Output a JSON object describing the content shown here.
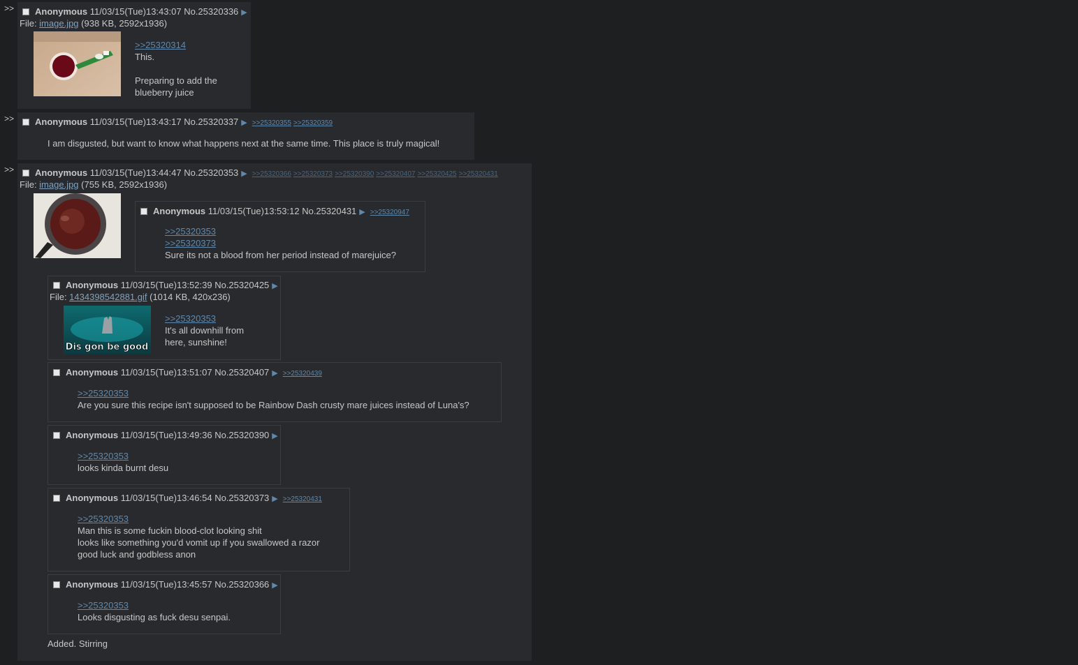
{
  "arrow": ">>",
  "post1": {
    "name": "Anonymous",
    "date": "11/03/15(Tue)13:43:07",
    "no": "No.25320336",
    "file_prefix": "File: ",
    "file_name": "image.jpg",
    "file_info": " (938 KB, 2592x1936)",
    "quote": ">>25320314",
    "line1": "This.",
    "line2": "Preparing to add the",
    "line3": "blueberry juice"
  },
  "post2": {
    "name": "Anonymous",
    "date": "11/03/15(Tue)13:43:17",
    "no": "No.25320337",
    "backlinks": [
      ">>25320355",
      ">>25320359"
    ],
    "text": "I am disgusted, but want to know what happens next at the same time. This place is truly magical!"
  },
  "post3": {
    "name": "Anonymous",
    "date": "11/03/15(Tue)13:44:47",
    "no": "No.25320353",
    "backlinks": [
      ">>25320366",
      ">>25320373",
      ">>25320390",
      ">>25320407",
      ">>25320425",
      ">>25320431"
    ],
    "file_prefix": "File: ",
    "file_name": "image.jpg",
    "file_info": " (755 KB, 2592x1936)",
    "text": "Added. Stirring"
  },
  "r431": {
    "name": "Anonymous",
    "date": "11/03/15(Tue)13:53:12",
    "no": "No.25320431",
    "backlinks": [
      ">>25320947"
    ],
    "quote1": ">>25320353",
    "quote2": ">>25320373",
    "text": "Sure its not a blood from her period instead of marejuice?"
  },
  "r425": {
    "name": "Anonymous",
    "date": "11/03/15(Tue)13:52:39",
    "no": "No.25320425",
    "file_prefix": "File: ",
    "file_name": "1434398542881.gif",
    "file_info": " (1014 KB, 420x236)",
    "gif_caption": "Dis gon be good",
    "quote": ">>25320353",
    "line1": "It's all downhill from",
    "line2": "here, sunshine!"
  },
  "r407": {
    "name": "Anonymous",
    "date": "11/03/15(Tue)13:51:07",
    "no": "No.25320407",
    "backlinks": [
      ">>25320439"
    ],
    "quote": ">>25320353",
    "text": "Are you sure this recipe isn't supposed to be Rainbow Dash crusty mare juices instead of Luna's?"
  },
  "r390": {
    "name": "Anonymous",
    "date": "11/03/15(Tue)13:49:36",
    "no": "No.25320390",
    "quote": ">>25320353",
    "text": "looks kinda burnt desu"
  },
  "r373": {
    "name": "Anonymous",
    "date": "11/03/15(Tue)13:46:54",
    "no": "No.25320373",
    "backlinks": [
      ">>25320431"
    ],
    "quote": ">>25320353",
    "line1": "Man this is some fuckin blood-clot looking shit",
    "line2": "looks like something you'd vomit up if you swallowed a razor",
    "line3": "good luck and godbless anon"
  },
  "r366": {
    "name": "Anonymous",
    "date": "11/03/15(Tue)13:45:57",
    "no": "No.25320366",
    "quote": ">>25320353",
    "text": "Looks disgusting as fuck desu senpai."
  },
  "icons": {
    "checkbox": "checkbox-icon",
    "menu": "triangle-menu-icon"
  }
}
